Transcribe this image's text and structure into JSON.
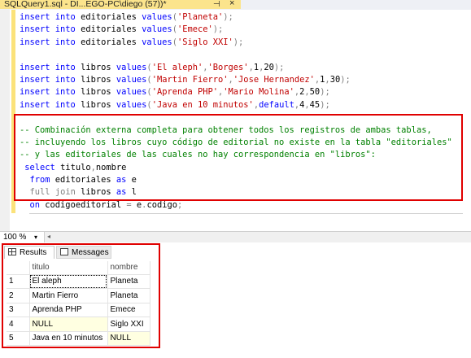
{
  "tab": {
    "title": "SQLQuery1.sql - DI...EGO-PC\\diego (57))*",
    "pin_icon": "pin-icon",
    "close_icon": "close-icon"
  },
  "editor": {
    "code_lines": [
      [
        [
          "kw",
          "insert into"
        ],
        [
          "t",
          " editoriales "
        ],
        [
          "kw",
          "values"
        ],
        [
          "gry",
          "("
        ],
        [
          "str",
          "'Planeta'"
        ],
        [
          "gry",
          ");"
        ]
      ],
      [
        [
          "kw",
          "insert into"
        ],
        [
          "t",
          " editoriales "
        ],
        [
          "kw",
          "values"
        ],
        [
          "gry",
          "("
        ],
        [
          "str",
          "'Emece'"
        ],
        [
          "gry",
          ");"
        ]
      ],
      [
        [
          "kw",
          "insert into"
        ],
        [
          "t",
          " editoriales "
        ],
        [
          "kw",
          "values"
        ],
        [
          "gry",
          "("
        ],
        [
          "str",
          "'Siglo XXI'"
        ],
        [
          "gry",
          ");"
        ]
      ],
      [],
      [
        [
          "kw",
          "insert into"
        ],
        [
          "t",
          " libros "
        ],
        [
          "kw",
          "values"
        ],
        [
          "gry",
          "("
        ],
        [
          "str",
          "'El aleph'"
        ],
        [
          "gry",
          ","
        ],
        [
          "str",
          "'Borges'"
        ],
        [
          "gry",
          ","
        ],
        [
          "t",
          "1"
        ],
        [
          "gry",
          ","
        ],
        [
          "t",
          "20"
        ],
        [
          "gry",
          ");"
        ]
      ],
      [
        [
          "kw",
          "insert into"
        ],
        [
          "t",
          " libros "
        ],
        [
          "kw",
          "values"
        ],
        [
          "gry",
          "("
        ],
        [
          "str",
          "'Martin Fierro'"
        ],
        [
          "gry",
          ","
        ],
        [
          "str",
          "'Jose Hernandez'"
        ],
        [
          "gry",
          ","
        ],
        [
          "t",
          "1"
        ],
        [
          "gry",
          ","
        ],
        [
          "t",
          "30"
        ],
        [
          "gry",
          ");"
        ]
      ],
      [
        [
          "kw",
          "insert into"
        ],
        [
          "t",
          " libros "
        ],
        [
          "kw",
          "values"
        ],
        [
          "gry",
          "("
        ],
        [
          "str",
          "'Aprenda PHP'"
        ],
        [
          "gry",
          ","
        ],
        [
          "str",
          "'Mario Molina'"
        ],
        [
          "gry",
          ","
        ],
        [
          "t",
          "2"
        ],
        [
          "gry",
          ","
        ],
        [
          "t",
          "50"
        ],
        [
          "gry",
          ");"
        ]
      ],
      [
        [
          "kw",
          "insert into"
        ],
        [
          "t",
          " libros "
        ],
        [
          "kw",
          "values"
        ],
        [
          "gry",
          "("
        ],
        [
          "str",
          "'Java en 10 minutos'"
        ],
        [
          "gry",
          ","
        ],
        [
          "kw",
          "default"
        ],
        [
          "gry",
          ","
        ],
        [
          "t",
          "4"
        ],
        [
          "gry",
          ","
        ],
        [
          "t",
          "45"
        ],
        [
          "gry",
          ");"
        ]
      ],
      [],
      [
        [
          "cmt",
          "-- Combinación externa completa para obtener todos los registros de ambas tablas,"
        ]
      ],
      [
        [
          "cmt",
          "-- incluyendo los libros cuyo código de editorial no existe en la tabla \"editoriales\""
        ]
      ],
      [
        [
          "cmt",
          "-- y las editoriales de las cuales no hay correspondencia en \"libros\":"
        ]
      ],
      [
        [
          "t",
          " "
        ],
        [
          "kw",
          "select"
        ],
        [
          "t",
          " titulo"
        ],
        [
          "gry",
          ","
        ],
        [
          "t",
          "nombre"
        ]
      ],
      [
        [
          "t",
          "  "
        ],
        [
          "kw",
          "from"
        ],
        [
          "t",
          " editoriales "
        ],
        [
          "kw",
          "as"
        ],
        [
          "t",
          " e"
        ]
      ],
      [
        [
          "t",
          "  "
        ],
        [
          "gry",
          "full"
        ],
        [
          "t",
          " "
        ],
        [
          "gry",
          "join"
        ],
        [
          "t",
          " libros "
        ],
        [
          "kw",
          "as"
        ],
        [
          "t",
          " l"
        ]
      ],
      [
        [
          "t",
          "  "
        ],
        [
          "kw",
          "on"
        ],
        [
          "t",
          " codigoeditorial "
        ],
        [
          "gry",
          "="
        ],
        [
          "t",
          " e"
        ],
        [
          "gry",
          "."
        ],
        [
          "t",
          "codigo"
        ],
        [
          "gry",
          ";"
        ]
      ]
    ]
  },
  "statusbar": {
    "zoom": "100 %",
    "zoom_arrow": "▾",
    "scroll_left": "◂"
  },
  "results": {
    "tabs": [
      {
        "label": "Results",
        "icon": "grid-icon",
        "active": true
      },
      {
        "label": "Messages",
        "icon": "messages-icon",
        "active": false
      }
    ],
    "columns": [
      "titulo",
      "nombre"
    ],
    "rows": [
      {
        "n": "1",
        "titulo": "El aleph",
        "nombre": "Planeta"
      },
      {
        "n": "2",
        "titulo": "Martin Fierro",
        "nombre": "Planeta"
      },
      {
        "n": "3",
        "titulo": "Aprenda PHP",
        "nombre": "Emece"
      },
      {
        "n": "4",
        "titulo": "NULL",
        "nombre": "Siglo XXI"
      },
      {
        "n": "5",
        "titulo": "Java en 10 minutos",
        "nombre": "NULL"
      }
    ]
  }
}
